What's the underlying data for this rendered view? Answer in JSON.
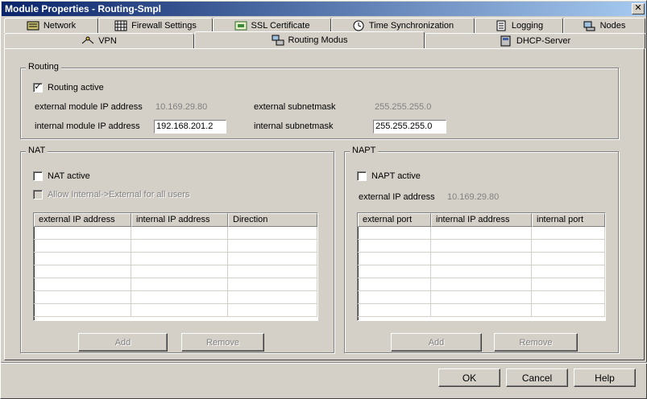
{
  "window": {
    "title": "Module Properties - Routing-Smpl",
    "close_glyph": "✕"
  },
  "tabs_row1": [
    {
      "label": "Network",
      "icon": "network-icon"
    },
    {
      "label": "Firewall Settings",
      "icon": "firewall-icon"
    },
    {
      "label": "SSL Certificate",
      "icon": "certificate-icon"
    },
    {
      "label": "Time Synchronization",
      "icon": "clock-icon"
    },
    {
      "label": "Logging",
      "icon": "log-icon"
    },
    {
      "label": "Nodes",
      "icon": "nodes-icon"
    }
  ],
  "tabs_row2": [
    {
      "label": "VPN",
      "icon": "vpn-icon"
    },
    {
      "label": "Routing Modus",
      "icon": "routing-icon",
      "active": true
    },
    {
      "label": "DHCP-Server",
      "icon": "dhcp-icon"
    }
  ],
  "routing": {
    "group_label": "Routing",
    "active_label": "Routing active",
    "active_checked": true,
    "ext_ip_label": "external module IP address",
    "ext_ip_value": "10.169.29.80",
    "ext_mask_label": "external subnetmask",
    "ext_mask_value": "255.255.255.0",
    "int_ip_label": "internal module IP address",
    "int_ip_value": "192.168.201.2",
    "int_mask_label": "internal subnetmask",
    "int_mask_value": "255.255.255.0"
  },
  "nat": {
    "group_label": "NAT",
    "active_label": "NAT active",
    "allow_label": "Allow Internal->External for all users",
    "columns": [
      "external IP address",
      "internal IP address",
      "Direction"
    ],
    "add_label": "Add",
    "remove_label": "Remove"
  },
  "napt": {
    "group_label": "NAPT",
    "active_label": "NAPT active",
    "ext_ip_label": "external IP address",
    "ext_ip_value": "10.169.29.80",
    "columns": [
      "external port",
      "internal IP address",
      "internal port"
    ],
    "add_label": "Add",
    "remove_label": "Remove"
  },
  "footer": {
    "ok_label": "OK",
    "cancel_label": "Cancel",
    "help_label": "Help"
  },
  "colors": {
    "titlebar_start": "#0a246a",
    "titlebar_end": "#a6caf0",
    "face": "#d4d0c8",
    "disabled_text": "#808080"
  }
}
